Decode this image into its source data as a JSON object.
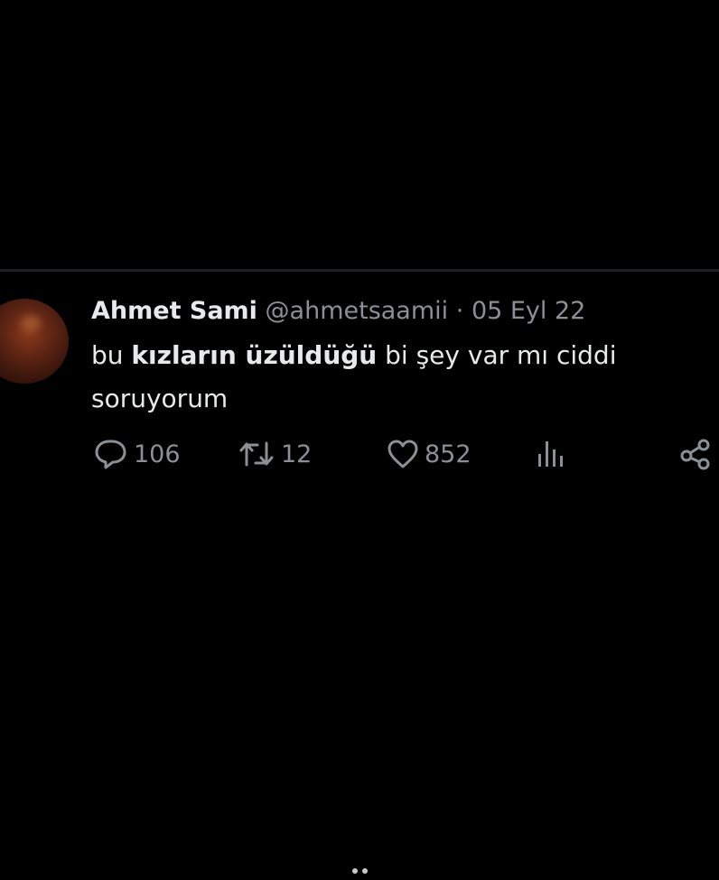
{
  "tweet": {
    "author_name": "Ahmet Sami",
    "handle": "@ahmetsaamii",
    "separator": "·",
    "date": "05 Eyl 22",
    "text": {
      "part1": "bu ",
      "bold": "kızların üzüldüğü",
      "part2": " bi şey var mı ciddi soruyorum"
    },
    "actions": {
      "reply_count": "106",
      "retweet_count": "12",
      "like_count": "852"
    }
  },
  "icons": {
    "reply": "speech-bubble-icon",
    "retweet": "retweet-arrows-icon",
    "like": "heart-icon",
    "views": "bar-chart-icon",
    "share": "share-icon"
  },
  "colors": {
    "background": "#000000",
    "primary_text": "#e7e9ea",
    "secondary_text": "#8b9095",
    "divider": "#1f2124"
  },
  "carousel": {
    "page_count": 2
  }
}
